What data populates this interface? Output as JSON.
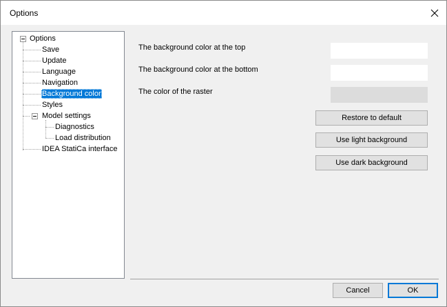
{
  "window": {
    "title": "Options"
  },
  "tree": {
    "root": {
      "label": "Options"
    },
    "items": [
      {
        "label": "Save"
      },
      {
        "label": "Update"
      },
      {
        "label": "Language"
      },
      {
        "label": "Navigation"
      },
      {
        "label": "Background color",
        "selected": true
      },
      {
        "label": "Styles"
      },
      {
        "label": "Model settings",
        "children": [
          {
            "label": "Diagnostics"
          },
          {
            "label": "Load distribution"
          }
        ]
      },
      {
        "label": "IDEA StatiCa interface"
      }
    ]
  },
  "settings": {
    "top_color_label": "The background color at the top",
    "bottom_color_label": "The background color at the bottom",
    "raster_color_label": "The color of the raster",
    "top_color": "#ffffff",
    "bottom_color": "#ffffff",
    "raster_color": "#dcdcdc"
  },
  "actions": {
    "restore_default": "Restore to default",
    "light_background": "Use light background",
    "dark_background": "Use dark background"
  },
  "footer": {
    "cancel": "Cancel",
    "ok": "OK"
  }
}
